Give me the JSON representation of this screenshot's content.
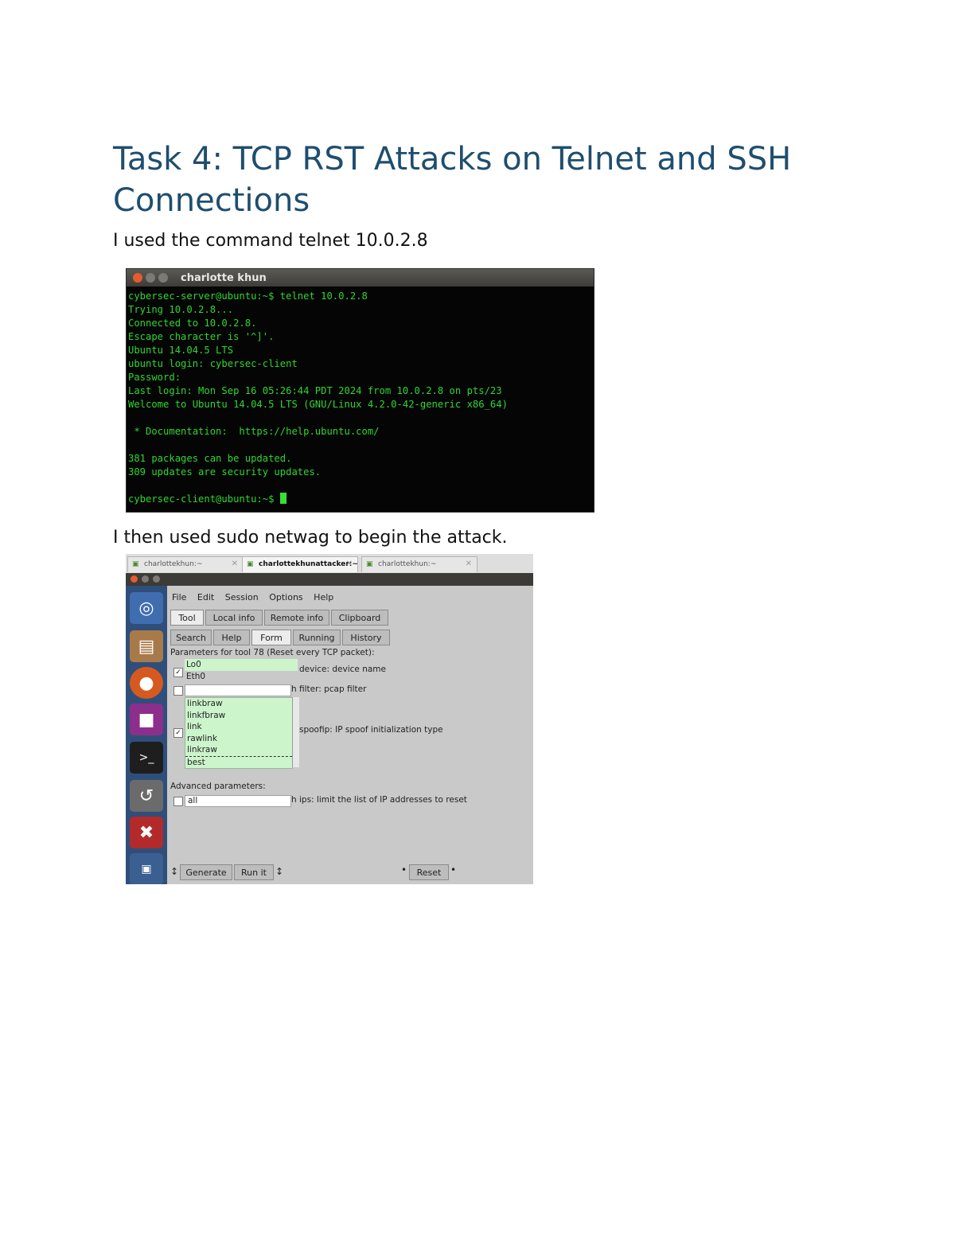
{
  "title": "Task 4: TCP RST Attacks on Telnet and SSH Connections",
  "para1": "I used the command telnet 10.0.2.8",
  "para2": "I then used sudo netwag to begin the attack.",
  "terminal": {
    "window_title": "charlotte khun",
    "lines": [
      "cybersec-server@ubuntu:~$ telnet 10.0.2.8",
      "Trying 10.0.2.8...",
      "Connected to 10.0.2.8.",
      "Escape character is '^]'.",
      "Ubuntu 14.04.5 LTS",
      "ubuntu login: cybersec-client",
      "Password:",
      "Last login: Mon Sep 16 05:26:44 PDT 2024 from 10.0.2.8 on pts/23",
      "Welcome to Ubuntu 14.04.5 LTS (GNU/Linux 4.2.0-42-generic x86_64)",
      "",
      " * Documentation:  https://help.ubuntu.com/",
      "",
      "381 packages can be updated.",
      "309 updates are security updates.",
      ""
    ],
    "prompt": "cybersec-client@ubuntu:~$ "
  },
  "netwag": {
    "tabs": [
      "charlottekhun:~",
      "charlottekhunattacker:~",
      "charlottekhun:~"
    ],
    "menu": [
      "File",
      "Edit",
      "Session",
      "Options",
      "Help"
    ],
    "main_tabs": [
      "Tool",
      "Local info",
      "Remote info",
      "Clipboard"
    ],
    "sub_tabs": [
      "Search",
      "Help",
      "Form",
      "Running",
      "History"
    ],
    "params_header": "Parameters for tool 78 (Reset every TCP packet):",
    "device_options": [
      "Lo0",
      "Eth0"
    ],
    "device_label": "device: device name",
    "filter_label": "h filter: pcap filter",
    "spoof_options": [
      "linkbraw",
      "linkfbraw",
      "link",
      "rawlink",
      "linkraw",
      "best"
    ],
    "spoof_label": "spoofip: IP spoof initialization type",
    "advanced_label": "Advanced parameters:",
    "ips_value": "all",
    "ips_label": "h ips: limit the list of IP addresses to reset",
    "buttons": {
      "generate": "Generate",
      "run": "Run it",
      "reset": "Reset"
    },
    "colors": {
      "launcher": "#2f4f7a",
      "listbox": "#ccf5cc"
    }
  }
}
